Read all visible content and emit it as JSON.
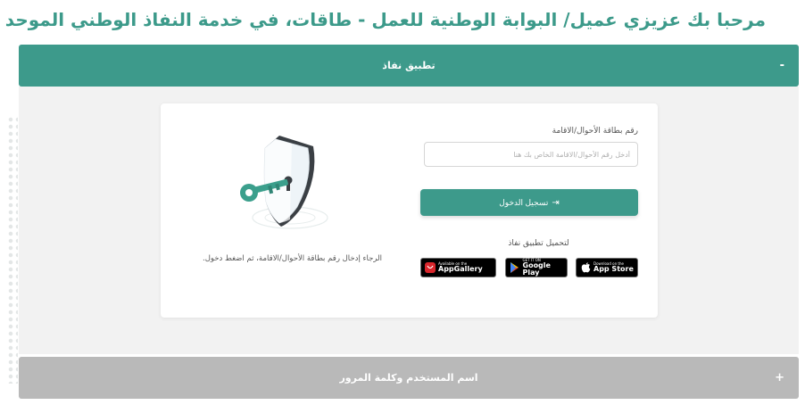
{
  "header": {
    "title": "مرحبا بك عزيزي عميل/ البوابة الوطنية للعمل - طاقات، في خدمة النفاذ الوطني الموحد"
  },
  "nafath_panel": {
    "title": "تطبيق نفاذ",
    "toggle": "-"
  },
  "login_form": {
    "id_label": "رقم بطاقة الأحوال/الاقامة",
    "id_placeholder": "أدخل رقم الأحوال/الاقامة الخاص بك هنا",
    "login_button": "تسجيل الدخول",
    "download_label": "لتحميل تطبيق نفاذ",
    "hint": "الرجاء إدخال رقم بطاقة الأحوال/الاقامة، ثم اضغط دخول."
  },
  "stores": [
    {
      "small": "Available on the",
      "big": "AppGallery",
      "icon": "huawei-icon"
    },
    {
      "small": "GET IT ON",
      "big": "Google Play",
      "icon": "google-play-icon"
    },
    {
      "small": "Download on the",
      "big": "App Store",
      "icon": "apple-icon"
    }
  ],
  "credentials_panel": {
    "title": "اسم المستخدم وكلمة المرور",
    "toggle": "+"
  },
  "colors": {
    "primary": "#3d9a8b",
    "title": "#3c9a8a",
    "collapsed_panel": "#b9b9b9"
  }
}
